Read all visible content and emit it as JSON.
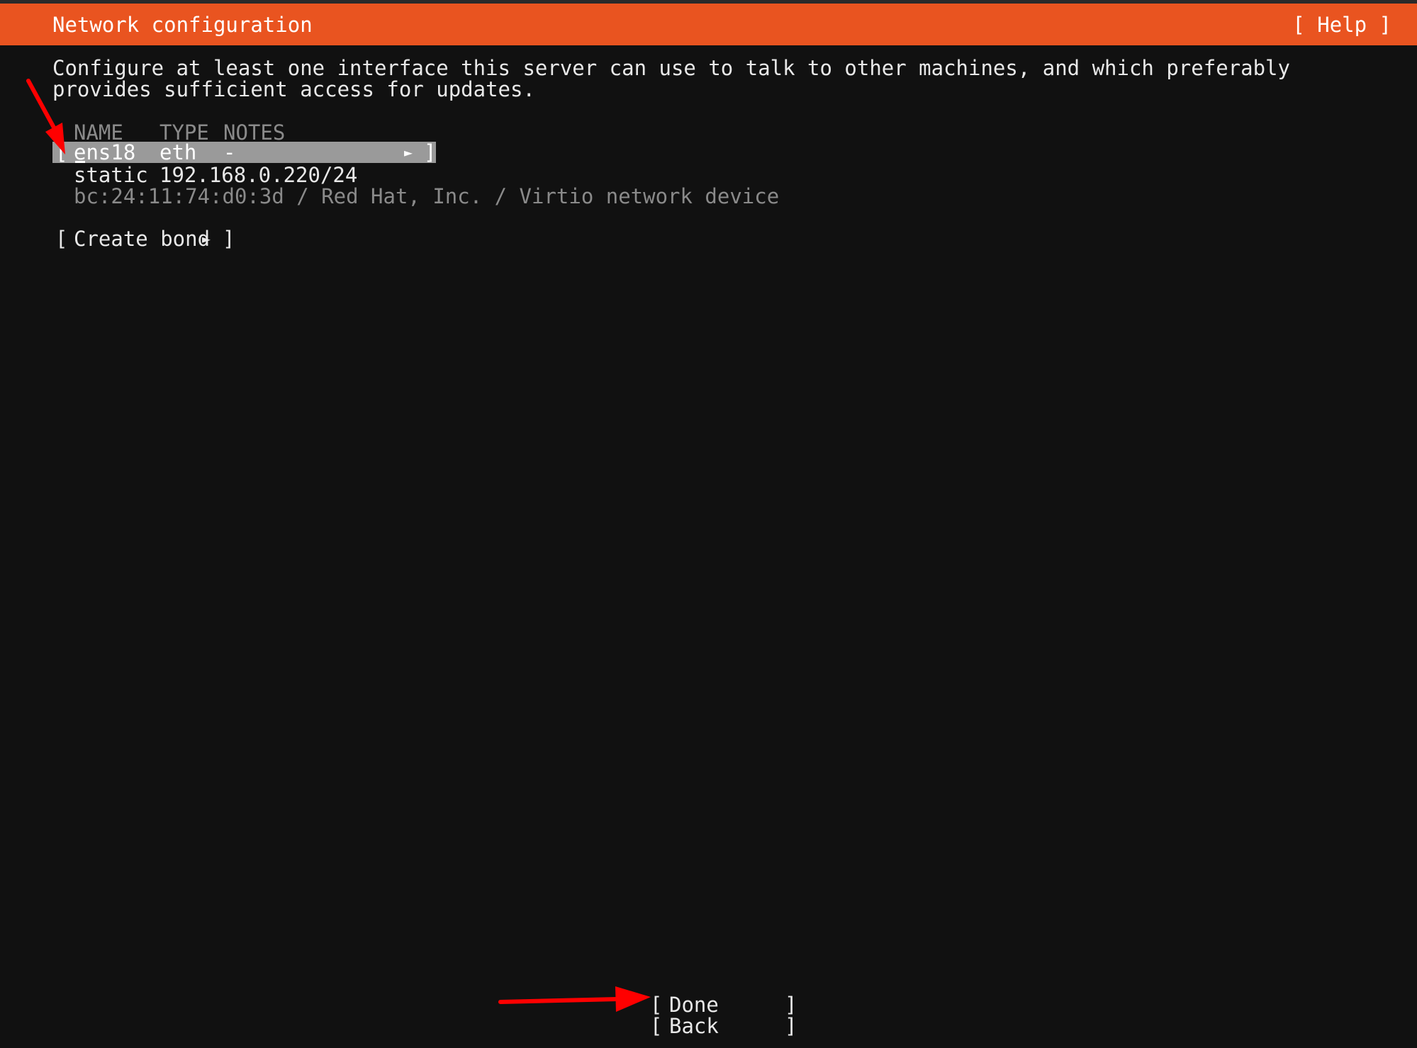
{
  "header": {
    "title": "Network configuration",
    "help_label": "[ Help ]",
    "accent_color": "#e95420"
  },
  "description": "Configure at least one interface this server can use to talk to other machines, and which preferably provides sufficient access for updates.",
  "table": {
    "columns": [
      "NAME",
      "TYPE",
      "NOTES"
    ],
    "interfaces": [
      {
        "open_bracket": "[",
        "name": "ens18",
        "type": "eth",
        "notes": "-",
        "arrow_icon": "triangle-right-icon",
        "arrow_glyph": "►",
        "close_bracket": "]",
        "address_mode": "static",
        "address": "192.168.0.220/24",
        "hardware": "bc:24:11:74:d0:3d / Red Hat, Inc. / Virtio network device"
      }
    ]
  },
  "create_bond": {
    "open_bracket": "[",
    "label": "Create bond",
    "arrow_glyph": "►",
    "close_bracket": "]"
  },
  "footer": {
    "done": {
      "open_bracket": "[",
      "label": "Done",
      "close_bracket": "]"
    },
    "back": {
      "open_bracket": "[",
      "label": "Back",
      "close_bracket": "]"
    }
  },
  "annotations": {
    "arrow_color": "#ff0000",
    "icons": [
      "red-arrow-icon",
      "red-arrow-icon"
    ]
  }
}
